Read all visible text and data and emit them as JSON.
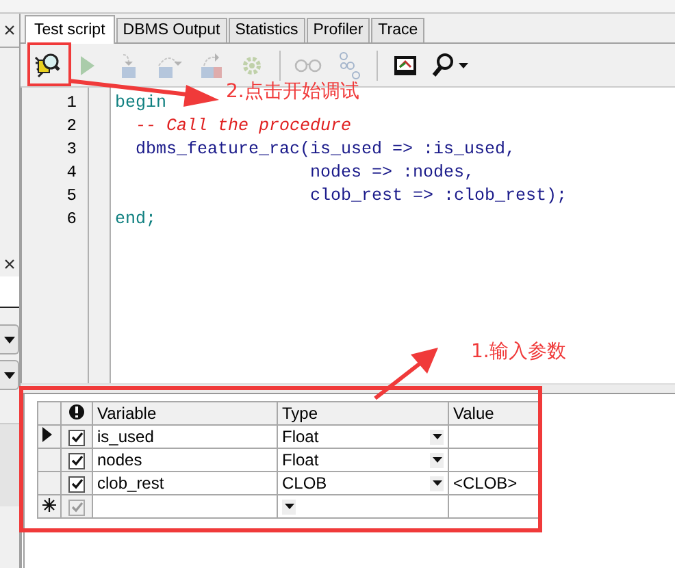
{
  "tabs": [
    {
      "label": "Test script",
      "selected": true
    },
    {
      "label": "DBMS Output",
      "selected": false
    },
    {
      "label": "Statistics",
      "selected": false
    },
    {
      "label": "Profiler",
      "selected": false
    },
    {
      "label": "Trace",
      "selected": false
    }
  ],
  "toolbar": [
    {
      "kind": "debug",
      "disabled": false
    },
    {
      "kind": "run",
      "disabled": true
    },
    {
      "kind": "step-into",
      "disabled": true
    },
    {
      "kind": "step-over",
      "disabled": true
    },
    {
      "kind": "step-out",
      "disabled": true
    },
    {
      "kind": "run-to-exception",
      "disabled": true
    },
    {
      "kind": "separator"
    },
    {
      "kind": "watch",
      "disabled": true
    },
    {
      "kind": "breakpoints",
      "disabled": true
    },
    {
      "kind": "separator"
    },
    {
      "kind": "output",
      "disabled": false
    },
    {
      "kind": "find",
      "disabled": false
    }
  ],
  "editor": {
    "lines": [
      {
        "number": "1",
        "segments": [
          {
            "kind": "keyword",
            "text": "begin"
          }
        ]
      },
      {
        "number": "2",
        "segments": [
          {
            "kind": "comment",
            "text": "  -- Call the procedure"
          }
        ]
      },
      {
        "number": "3",
        "segments": [
          {
            "kind": "plain",
            "text": "  dbms_feature_rac(is_used => :is_used,"
          }
        ]
      },
      {
        "number": "4",
        "segments": [
          {
            "kind": "plain",
            "text": "                   nodes => :nodes,"
          }
        ]
      },
      {
        "number": "5",
        "segments": [
          {
            "kind": "plain",
            "text": "                   clob_rest => :clob_rest);"
          }
        ]
      },
      {
        "number": "6",
        "segments": [
          {
            "kind": "keyword",
            "text": "end;"
          }
        ]
      }
    ]
  },
  "variables": {
    "columns": [
      "Variable",
      "Type",
      "Value"
    ],
    "rows": [
      {
        "kind": "variable",
        "current": true,
        "checked": true,
        "variable": "is_used",
        "type": "Float"
      },
      {
        "kind": "variable",
        "current": false,
        "checked": true,
        "variable": "nodes",
        "type": "Float"
      },
      {
        "kind": "variable",
        "current": false,
        "checked": true,
        "variable": "clob_rest",
        "type": "CLOB",
        "value": "<CLOB>"
      },
      {
        "kind": "new",
        "checked": true
      }
    ]
  },
  "annotations": [
    {
      "text": "2.点击开始调试"
    },
    {
      "text": "1.输入参数"
    }
  ]
}
